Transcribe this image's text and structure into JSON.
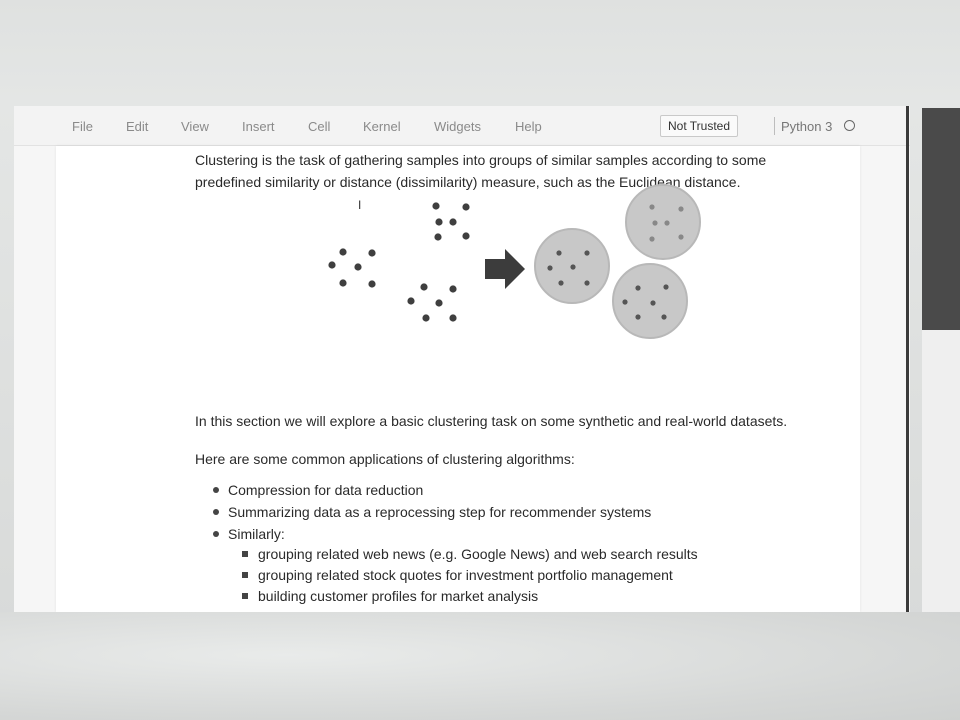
{
  "menubar": {
    "items": [
      "File",
      "Edit",
      "View",
      "Insert",
      "Cell",
      "Kernel",
      "Widgets",
      "Help"
    ],
    "trusted_label": "Not Trusted",
    "kernel_name": "Python 3",
    "kernel_status_icon": "kernel-idle-circle-icon"
  },
  "notebook": {
    "intro_line1": "Clustering is the task of gathering samples into groups of similar samples according to some",
    "intro_line2": "predefined similarity or distance (dissimilarity) measure, such as the Euclidean distance.",
    "cursor_glyph": "I",
    "section_text": "In this section we will explore a basic clustering task on some synthetic and real-world datasets.",
    "applications_heading": "Here are some common applications of clustering algorithms:",
    "applications": [
      "Compression for data reduction",
      "Summarizing data as a reprocessing step for recommender systems",
      "Similarly:"
    ],
    "sub_applications": [
      "grouping related web news (e.g. Google News) and web search results",
      "grouping related stock quotes for investment portfolio management",
      "building customer profiles for market analysis"
    ]
  },
  "diagram": {
    "point_color": "#3f3f3f",
    "cluster_fill": "#c8c8c8",
    "cluster_stroke": "#b5b5b5",
    "arrow_color": "#3c3c3c"
  }
}
